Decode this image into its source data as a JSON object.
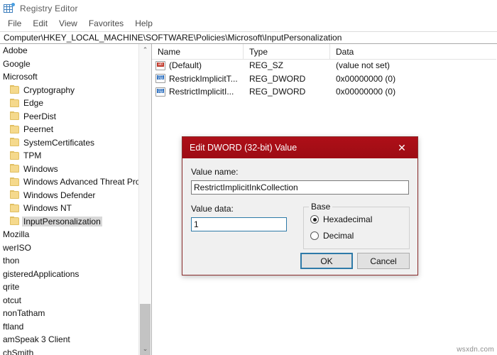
{
  "window": {
    "title": "Registry Editor",
    "icon": "registry-editor-icon"
  },
  "menubar": {
    "items": [
      {
        "label": "File"
      },
      {
        "label": "Edit"
      },
      {
        "label": "View"
      },
      {
        "label": "Favorites"
      },
      {
        "label": "Help"
      }
    ]
  },
  "address": {
    "path": "Computer\\HKEY_LOCAL_MACHINE\\SOFTWARE\\Policies\\Microsoft\\InputPersonalization"
  },
  "tree": {
    "scrollbar": {
      "up_arrow": "⌃",
      "down_arrow": "⌄"
    },
    "items": [
      {
        "label": "Adobe",
        "indent": 0,
        "folder": false,
        "selected": false
      },
      {
        "label": "Google",
        "indent": 0,
        "folder": false,
        "selected": false
      },
      {
        "label": "Microsoft",
        "indent": 0,
        "folder": false,
        "selected": false
      },
      {
        "label": "Cryptography",
        "indent": 12,
        "folder": true,
        "selected": false
      },
      {
        "label": "Edge",
        "indent": 12,
        "folder": true,
        "selected": false
      },
      {
        "label": "PeerDist",
        "indent": 12,
        "folder": true,
        "selected": false
      },
      {
        "label": "Peernet",
        "indent": 12,
        "folder": true,
        "selected": false
      },
      {
        "label": "SystemCertificates",
        "indent": 12,
        "folder": true,
        "selected": false
      },
      {
        "label": "TPM",
        "indent": 12,
        "folder": true,
        "selected": false
      },
      {
        "label": "Windows",
        "indent": 12,
        "folder": true,
        "selected": false
      },
      {
        "label": "Windows Advanced Threat Protec",
        "indent": 12,
        "folder": true,
        "selected": false
      },
      {
        "label": "Windows Defender",
        "indent": 12,
        "folder": true,
        "selected": false
      },
      {
        "label": "Windows NT",
        "indent": 12,
        "folder": true,
        "selected": false
      },
      {
        "label": "InputPersonalization",
        "indent": 12,
        "folder": true,
        "selected": true
      },
      {
        "label": "Mozilla",
        "indent": 0,
        "folder": false,
        "selected": false
      },
      {
        "label": "werISO",
        "indent": -3,
        "folder": false,
        "selected": false
      },
      {
        "label": "thon",
        "indent": -3,
        "folder": false,
        "selected": false
      },
      {
        "label": "gisteredApplications",
        "indent": -3,
        "folder": false,
        "selected": false
      },
      {
        "label": "qrite",
        "indent": -3,
        "folder": false,
        "selected": false
      },
      {
        "label": "otcut",
        "indent": -3,
        "folder": false,
        "selected": false
      },
      {
        "label": "nonTatham",
        "indent": -3,
        "folder": false,
        "selected": false
      },
      {
        "label": "ftland",
        "indent": -3,
        "folder": false,
        "selected": false
      },
      {
        "label": "amSpeak 3 Client",
        "indent": -3,
        "folder": false,
        "selected": false
      },
      {
        "label": "chSmith",
        "indent": -3,
        "folder": false,
        "selected": false
      }
    ]
  },
  "list": {
    "columns": [
      {
        "label": "Name"
      },
      {
        "label": "Type"
      },
      {
        "label": "Data"
      }
    ],
    "rows": [
      {
        "icon": "string-value-icon",
        "icon_text": "ab",
        "icon_kind": "sz",
        "name": "(Default)",
        "type": "REG_SZ",
        "data": "(value not set)"
      },
      {
        "icon": "dword-value-icon",
        "icon_text": "011",
        "icon_kind": "dw",
        "name": "RestrickImplicitT...",
        "type": "REG_DWORD",
        "data": "0x00000000 (0)"
      },
      {
        "icon": "dword-value-icon",
        "icon_text": "011",
        "icon_kind": "dw",
        "name": "RestrictImplicitI...",
        "type": "REG_DWORD",
        "data": "0x00000000 (0)"
      }
    ]
  },
  "dialog": {
    "title": "Edit DWORD (32-bit) Value",
    "close_glyph": "✕",
    "value_name_label": "Value name:",
    "value_name": "RestrictImplicitInkCollection",
    "value_data_label": "Value data:",
    "value_data": "1",
    "base_group_label": "Base",
    "base_options": [
      {
        "label": "Hexadecimal",
        "selected": true
      },
      {
        "label": "Decimal",
        "selected": false
      }
    ],
    "ok_label": "OK",
    "cancel_label": "Cancel",
    "title_color": "#a80d16",
    "focus_color": "#2e7aa8"
  },
  "watermark": {
    "text": "wsxdn.com"
  }
}
